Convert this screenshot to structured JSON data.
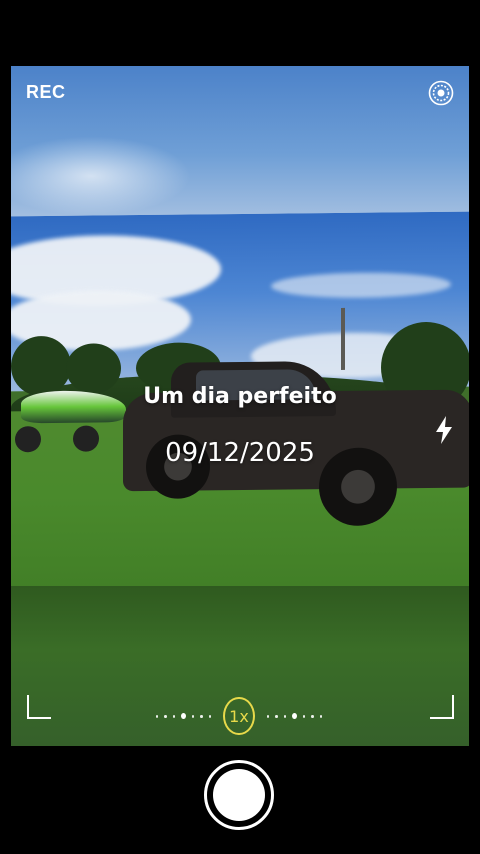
{
  "status": {
    "rec_label": "REC"
  },
  "caption": {
    "title": "Um dia perfeito",
    "date": "09/12/2025"
  },
  "zoom": {
    "label": "1x"
  },
  "icons": {
    "settings": "settings-icon",
    "flash": "flash-icon",
    "shutter": "shutter-button"
  },
  "colors": {
    "zoom_accent": "#e7d94a"
  }
}
